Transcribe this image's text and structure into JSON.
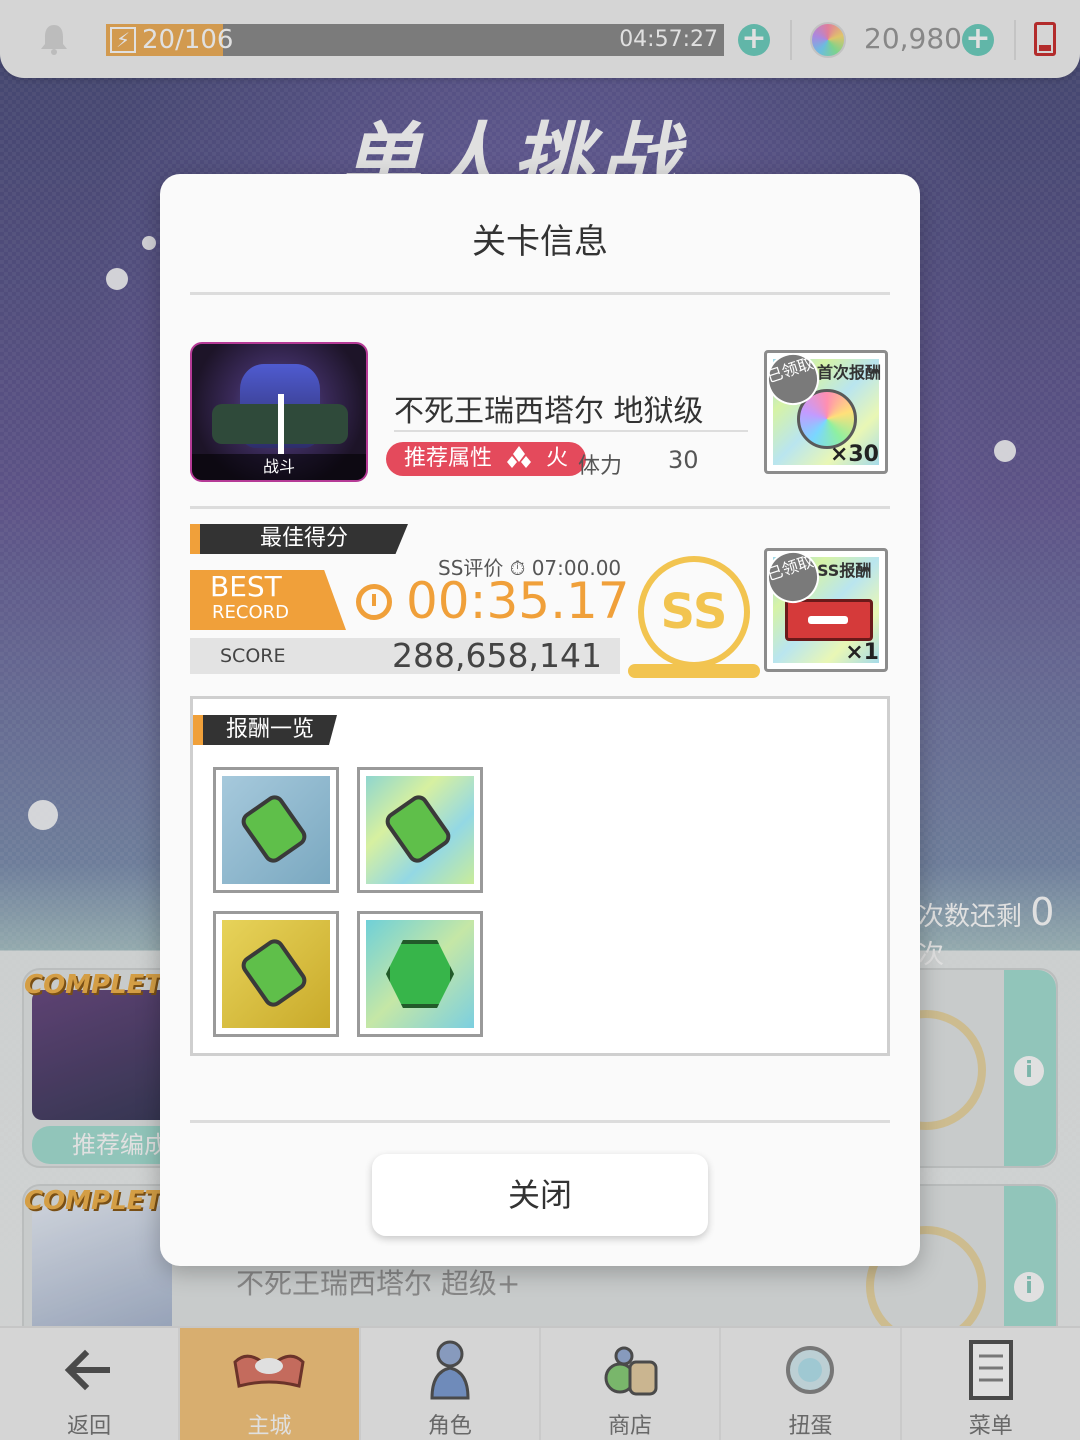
{
  "topbar": {
    "stamina_text": "20/106",
    "stamina_fraction": 0.19,
    "stamina_timer": "04:57:27",
    "gem_count": "20,980",
    "icons": [
      "bell-icon",
      "bolt-icon",
      "plus-icon",
      "gem-icon",
      "battery-icon"
    ]
  },
  "background": {
    "title": "单人挑战",
    "remaining_prefix": "次数还剩",
    "remaining_count": "0",
    "remaining_suffix": "次",
    "card1_complete": "COMPLETE!!",
    "card1_recommend": "推荐编成",
    "card2_complete": "COMPLETE!!",
    "card2_stage_name": "不死王瑞西塔尔 超级+"
  },
  "modal": {
    "title": "关卡信息",
    "stage": {
      "thumb_label": "战斗",
      "name": "不死王瑞西塔尔 地狱级",
      "recommended_attr_label": "推荐属性",
      "recommended_attr": "火",
      "stamina_label": "体力",
      "stamina_cost": "30"
    },
    "first_reward": {
      "claimed": "已领取",
      "type": "首次报酬",
      "qty": "×30"
    },
    "best_score": {
      "section_title": "最佳得分",
      "badge_big": "BEST",
      "badge_small": "RECORD",
      "ss_requirement": "SS评价 ⏱ 07:00.00",
      "time": "00:35.17",
      "score_label": "SCORE",
      "score": "288,658,141",
      "rank": "SS"
    },
    "ss_reward": {
      "claimed": "已领取",
      "type": "SS报酬",
      "qty": "×1"
    },
    "rewards": {
      "section_title": "报酬一览",
      "items": [
        "green-bottle-blue",
        "green-bottle-holo",
        "green-bottle-gold",
        "green-crystal"
      ]
    },
    "close_label": "关闭"
  },
  "nav": {
    "items": [
      {
        "label": "返回",
        "icon": "back-arrow-icon"
      },
      {
        "label": "主城",
        "icon": "castle-icon"
      },
      {
        "label": "角色",
        "icon": "character-icon"
      },
      {
        "label": "商店",
        "icon": "shop-icon"
      },
      {
        "label": "扭蛋",
        "icon": "gacha-icon"
      },
      {
        "label": "菜单",
        "icon": "menu-icon"
      }
    ],
    "active_index": 1
  },
  "colors": {
    "accent_orange": "#f0a03a",
    "fire_red": "#e44a5c",
    "mint": "#6fd0c0",
    "ss_gold": "#f2c450"
  }
}
